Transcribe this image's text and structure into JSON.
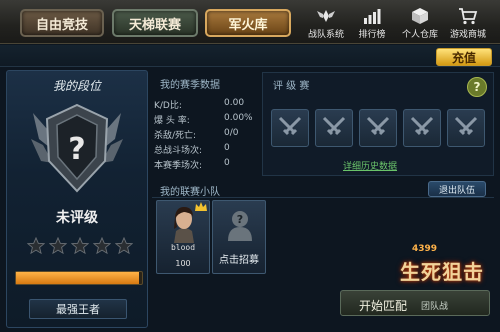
{
  "top_tabs": [
    {
      "label": "自由竞技"
    },
    {
      "label": "天梯联赛"
    },
    {
      "label": "军火库"
    }
  ],
  "nav": [
    {
      "label": "战队系统",
      "icon": "team-wings-icon"
    },
    {
      "label": "排行榜",
      "icon": "bar-chart-icon"
    },
    {
      "label": "个人仓库",
      "icon": "box-icon"
    },
    {
      "label": "游戏商城",
      "icon": "cart-icon"
    }
  ],
  "recharge_label": "充值",
  "rank_panel": {
    "title": "我的段位",
    "rank": "未评级",
    "stars_filled": 0,
    "stars_total": 5,
    "progress": 0.98,
    "bottom_label": "最强王者"
  },
  "season": {
    "title": "我的赛季数据",
    "rows": [
      {
        "key": "K/D比:",
        "value": "0.00"
      },
      {
        "key": "爆 头 率:",
        "value": "0.00%"
      },
      {
        "key": "杀敌/死亡:",
        "value": "0/0"
      },
      {
        "key": "总战斗场次:",
        "value": "0"
      },
      {
        "key": "本赛季场次:",
        "value": "0"
      }
    ]
  },
  "ranked": {
    "title": "评 级 赛",
    "help": "?",
    "history_link": "详细历史数据",
    "slots": 5
  },
  "team": {
    "title": "我的联赛小队",
    "quit_label": "退出队伍",
    "members": [
      {
        "name": "blood",
        "score": "100"
      }
    ],
    "recruit_label": "点击招募"
  },
  "logo": {
    "number": "4399",
    "title": "生死狙击"
  },
  "start": {
    "label": "开始匹配",
    "mode": "团队战"
  },
  "colors": {
    "accent": "#d49a12",
    "link": "#6ac46a"
  }
}
